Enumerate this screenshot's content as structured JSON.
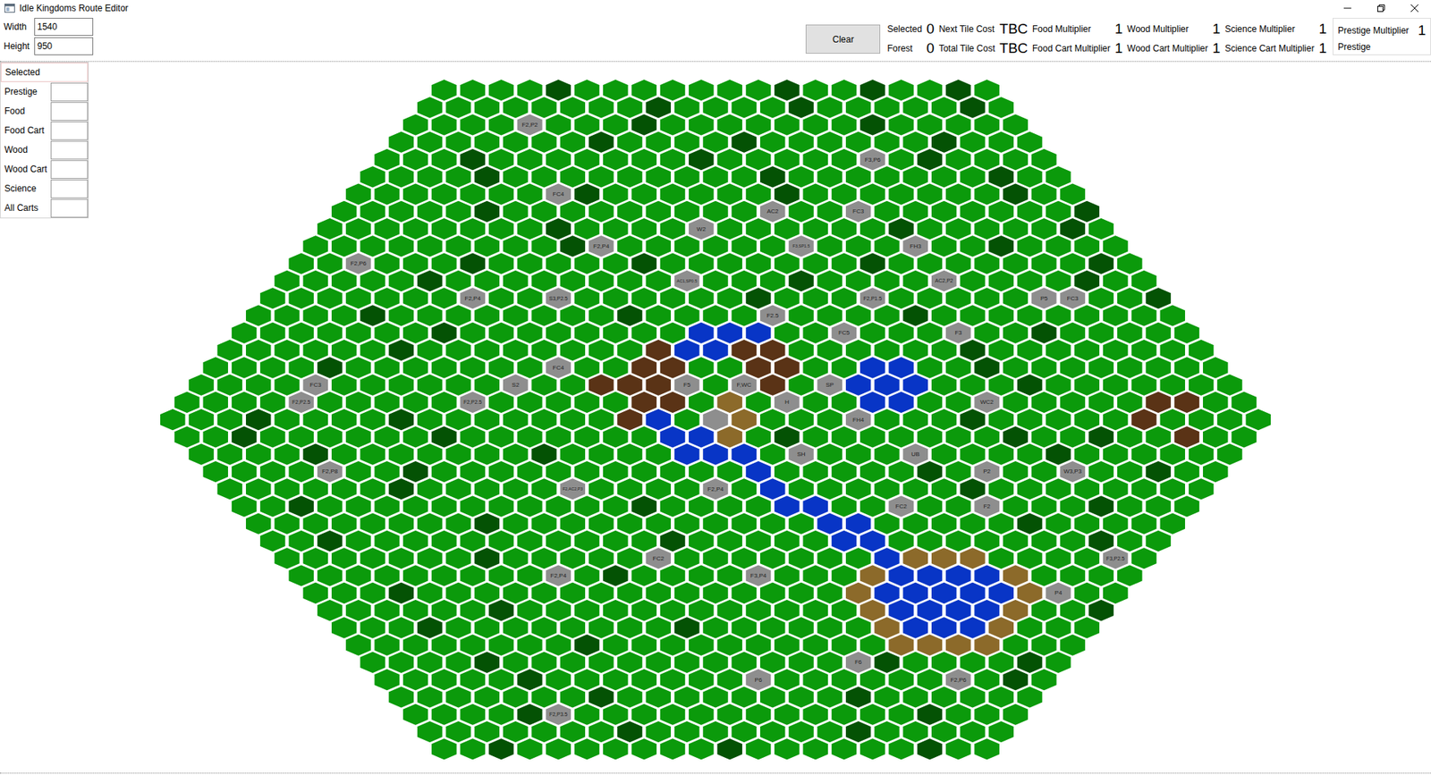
{
  "window": {
    "title": "Idle Kingdoms Route Editor"
  },
  "size_fields": [
    {
      "label": "Width",
      "value": "1540"
    },
    {
      "label": "Height",
      "value": "950"
    }
  ],
  "clear_button": "Clear",
  "stats": [
    [
      {
        "label": "Selected",
        "value": "0"
      },
      {
        "label": "Next Tile Cost",
        "value": "TBC"
      },
      {
        "label": "Food Multiplier",
        "value": "1"
      },
      {
        "label": "Wood Multiplier",
        "value": "1"
      },
      {
        "label": "Science Multiplier",
        "value": "1"
      }
    ],
    [
      {
        "label": "Forest",
        "value": "0"
      },
      {
        "label": "Total Tile Cost",
        "value": "TBC"
      },
      {
        "label": "Food Cart Multiplier",
        "value": "1"
      },
      {
        "label": "Wood Cart Multiplier",
        "value": "1"
      },
      {
        "label": "Science Cart Multiplier",
        "value": "1"
      }
    ]
  ],
  "prestige_box": {
    "label": "Prestige Multiplier",
    "value": "1",
    "sub_label": "Prestige"
  },
  "selected_panel": {
    "title": "Selected",
    "fields": [
      {
        "label": "Prestige",
        "value": ""
      },
      {
        "label": "Food",
        "value": ""
      },
      {
        "label": "Food Cart",
        "value": ""
      },
      {
        "label": "Wood",
        "value": ""
      },
      {
        "label": "Wood Cart",
        "value": ""
      },
      {
        "label": "Science",
        "value": ""
      },
      {
        "label": "All Carts",
        "value": ""
      }
    ]
  },
  "map": {
    "rows": [
      {
        "tiles": "GGGGDGGGGGGGDGGDGGDG",
        "labels": []
      },
      {
        "tiles": "GGGGGGGGDGGGGDGGGGGDG",
        "labels": []
      },
      {
        "tiles": "GGGGLGGGDGGGGGGGDGGGGG",
        "labels": [
          "F2,P2"
        ]
      },
      {
        "tiles": "GGGGGGGDGGGGDGGGGGGDGGG",
        "labels": []
      },
      {
        "tiles": "GGGDGGGGGGGDGGGGGLGDGGGG",
        "labels": [
          "F3,P6"
        ]
      },
      {
        "tiles": "GGGGDGGGGGGGGGDGGGGGGGDGG",
        "labels": []
      },
      {
        "tiles": "GGGGGGGLDGGGGGGDGGGGGGGDGG",
        "labels": [
          "FC4"
        ]
      },
      {
        "tiles": "GGGGGDGGGGGGGGGLGGLGGGGGGGD",
        "labels": [
          "AC2",
          "FC3"
        ]
      },
      {
        "tiles": "GGGGGGGGDGGGGLGGGGGGDGGGGGDG",
        "labels": [
          "W2"
        ]
      },
      {
        "tiles": "GGGGGGGGGDLGGGGGGLGGGLGGDGGGG",
        "labels": [
          "F2,P4",
          "F3,SP1.5",
          "FH3"
        ]
      },
      {
        "tiles": "GGLGGGDGGGGGDGGGGGGGDGGGGGGGDG",
        "labels": [
          "F2,P6"
        ]
      },
      {
        "tiles": "GGGGGDGGGGGGGGLGGGDGGGGLGGGGDGG",
        "labels": [
          "AC1,SP0.5",
          "AC2,P2"
        ]
      },
      {
        "tiles": "GGGGGGGLGGLGGGGGGDGGGLGGGGGLLGGD",
        "labels": [
          "F2,P4",
          "S3,P2.5",
          "F2,P1.5",
          "P5",
          "FC3"
        ]
      },
      {
        "tiles": "GGGGDGGGGGGGGDGGGGLGGGGDGGGGGGGGG",
        "labels": [
          "F2.5"
        ]
      },
      {
        "tiles": "GGGGGGGDGGGGGGGGWWWGGLGGGLGGDGGGGG",
        "labels": [
          "FC5",
          "F3"
        ]
      },
      {
        "tiles": "GGGGGGDGGGGGGGGBWWBBGGGGGGDGGGGGGGG",
        "labels": []
      },
      {
        "tiles": "GGGGDGGGGGGGLGGBBGGBBGGWWGGDGGGGGGGG",
        "labels": [
          "FC4"
        ]
      },
      {
        "tiles": "GGGGLGGGGGGLGGBBBLGLBGLWWWGGGDGGGGGGG",
        "labels": [
          "FC3",
          "S2",
          "F5",
          "F,WC",
          "SP"
        ]
      },
      {
        "tiles": "GGGGLGGGGGLGGGGGBBGTGLGGWWGGLGGGGGBBGG",
        "labels": [
          "F2,P2.5",
          "F2,P2.5",
          "H",
          "WC2"
        ]
      },
      {
        "tiles": "GGGDGGGGDGGGGGGGBWGXTGGGLGGGDGGGGGBGGGG",
        "labels": [
          "FH4"
        ]
      },
      {
        "tiles": "GGDGGGGGGDGGGGGGGWWTGDGGGGGGGDGGDGGBGG",
        "labels": []
      },
      {
        "tiles": "GGGGDGGGGGGGDGGGGWWWGLGGGLGGGGDGGGGGG",
        "labels": [
          "SH",
          "UB"
        ]
      },
      {
        "tiles": "GGGGLGGDGGGGGGGGGGGWGGGGGDGLGGLGGDGG",
        "labels": [
          "F2,P8",
          "P2",
          "W3,P3"
        ]
      },
      {
        "tiles": "GGGGGGDGGGGGLGGGGLGWGGGGGGDGGGGGGGG",
        "labels": [
          "F2,AC2,P3",
          "F2,P4"
        ]
      },
      {
        "tiles": "GGDGGGGGGGGGGGDGGGGWWGGLGGLGGGDGGG",
        "labels": [
          "FC2",
          "F2"
        ]
      },
      {
        "tiles": "GGGGGGGGDGGGGGGGGGGGWWGGGGGDGGGGG",
        "labels": []
      },
      {
        "tiles": "GGDGGGGGGGGGGGDGGGGGWWGGGGGGGDGG",
        "labels": []
      },
      {
        "tiles": "GGGGGGGDGGGGGLGGGGGGGWTTTGGGGLG",
        "labels": [
          "FC2",
          "F3,P2.5"
        ]
      },
      {
        "tiles": "GGGGGGGGGLGDGGGGLGGGTWWWWTGGGG",
        "labels": [
          "F2,P4",
          "F3,P4"
        ]
      },
      {
        "tiles": "GGGDGGGGGGGGGGGGGGGTWWWWWTLGG",
        "labels": [
          "P4"
        ]
      },
      {
        "tiles": "GGGGGGDGGGGGGGGGGGGTWWWWTGGD",
        "labels": []
      },
      {
        "tiles": "GGGDGGGGGGGGDGGGGGGTWWWTGGG",
        "labels": []
      },
      {
        "tiles": "GGGGGGGGDGGGGGGGGGGTTTTGGG",
        "labels": []
      },
      {
        "tiles": "GGGGDGGGGGGGGGGGGLDGGGGDG",
        "labels": [
          "F6"
        ]
      },
      {
        "tiles": "GGGGGDGGGGGGGLGGGGGGLGDG",
        "labels": [
          "P6",
          "F2,P6"
        ]
      },
      {
        "tiles": "GGGGGGGDGGGGGGGGDGGGGGG",
        "labels": []
      },
      {
        "tiles": "GGGGDLGGGGGGGGGGGGDGGG",
        "labels": [
          "F2,P3.5"
        ]
      },
      {
        "tiles": "GGGGGGGDGGGGGGGDGGGGG",
        "labels": []
      },
      {
        "tiles": "GGDGGGGGGGDGGGGGGDGG",
        "labels": []
      }
    ]
  }
}
